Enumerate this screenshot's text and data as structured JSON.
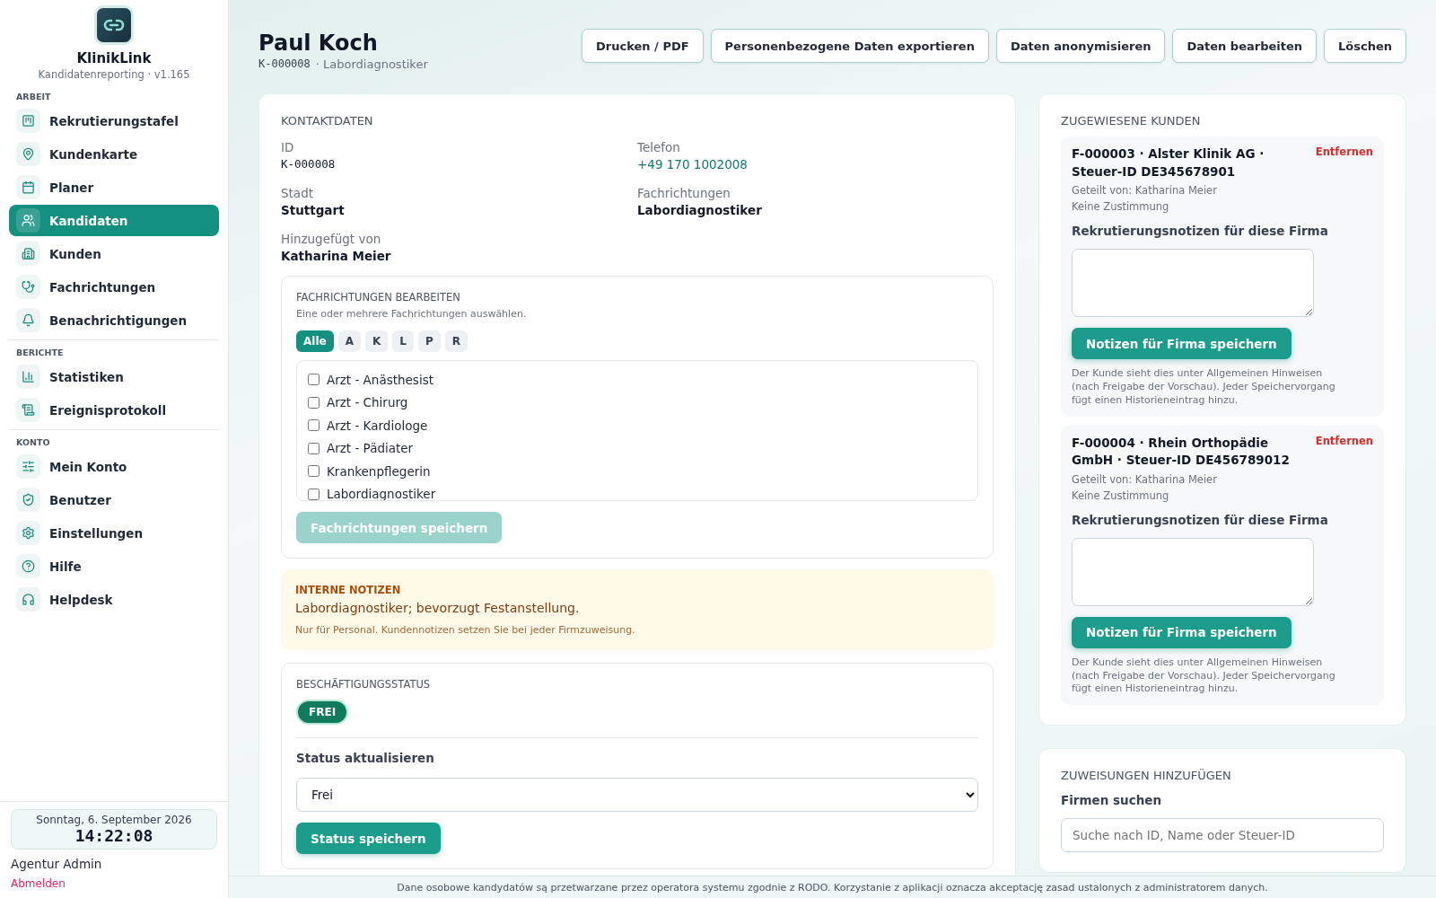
{
  "sidebar": {
    "brand": "KlinikLink",
    "subtitle": "Kandidatenreporting · v1.165",
    "sections": [
      {
        "heading": "ARBEIT",
        "items": [
          {
            "label": "Rekrutierungstafel",
            "selected": false
          },
          {
            "label": "Kundenkarte",
            "selected": false
          },
          {
            "label": "Planer",
            "selected": false
          },
          {
            "label": "Kandidaten",
            "selected": true
          },
          {
            "label": "Kunden",
            "selected": false
          },
          {
            "label": "Fachrichtungen",
            "selected": false
          },
          {
            "label": "Benachrichtigungen",
            "selected": false
          }
        ]
      },
      {
        "heading": "BERICHTE",
        "items": [
          {
            "label": "Statistiken",
            "selected": false
          },
          {
            "label": "Ereignisprotokoll",
            "selected": false
          }
        ]
      },
      {
        "heading": "KONTO",
        "items": [
          {
            "label": "Mein Konto",
            "selected": false
          },
          {
            "label": "Benutzer",
            "selected": false
          },
          {
            "label": "Einstellungen",
            "selected": false
          },
          {
            "label": "Hilfe",
            "selected": false
          },
          {
            "label": "Helpdesk",
            "selected": false
          }
        ]
      }
    ],
    "clock": {
      "date": "Sonntag, 6. September 2026",
      "time": "14:22:08"
    },
    "user": "Agentur Admin",
    "logout": "Abmelden"
  },
  "header": {
    "title": "Paul Koch",
    "id": "K-000008",
    "role": "· Labordiagnostiker",
    "actions": [
      "Drucken / PDF",
      "Personenbezogene Daten exportieren",
      "Daten anonymisieren",
      "Daten bearbeiten",
      "Löschen"
    ]
  },
  "contact": {
    "title": "KONTAKTDATEN",
    "fields": [
      {
        "label": "ID",
        "value": "K-000008",
        "kind": "mono"
      },
      {
        "label": "Telefon",
        "value": "+49 170 1002008",
        "kind": "link"
      },
      {
        "label": "Stadt",
        "value": "Stuttgart",
        "kind": "text"
      },
      {
        "label": "Fachrichtungen",
        "value": "Labordiagnostiker",
        "kind": "text"
      },
      {
        "label": "Hinzugefügt von",
        "value": "Katharina Meier",
        "kind": "text"
      }
    ]
  },
  "specialties": {
    "title": "FACHRICHTUNGEN BEARBEITEN",
    "hint": "Eine oder mehrere Fachrichtungen auswählen.",
    "filters": [
      {
        "label": "Alle",
        "selected": true
      },
      {
        "label": "A",
        "selected": false
      },
      {
        "label": "K",
        "selected": false
      },
      {
        "label": "L",
        "selected": false
      },
      {
        "label": "P",
        "selected": false
      },
      {
        "label": "R",
        "selected": false
      }
    ],
    "options": [
      {
        "label": "Arzt - Anästhesist",
        "checked": false
      },
      {
        "label": "Arzt - Chirurg",
        "checked": false
      },
      {
        "label": "Arzt - Kardiologe",
        "checked": false
      },
      {
        "label": "Arzt - Pädiater",
        "checked": false
      },
      {
        "label": "Krankenpflegerin",
        "checked": false
      },
      {
        "label": "Labordiagnostiker",
        "checked": false
      }
    ],
    "save": {
      "label": "Fachrichtungen speichern",
      "disabled": true
    }
  },
  "internal_notes": {
    "title": "INTERNE NOTIZEN",
    "text": "Labordiagnostiker; bevorzugt Festanstellung.",
    "hint": "Nur für Personal. Kundennotizen setzen Sie bei jeder Firmzuweisung."
  },
  "employment": {
    "title": "BESCHÄFTIGUNGSSTATUS",
    "badge": "FREI",
    "update_label": "Status aktualisieren",
    "select_value": "Frei",
    "save": "Status speichern"
  },
  "assigned": {
    "title": "ZUGEWIESENE KUNDEN",
    "clients": [
      {
        "name": "F-000003 · Alster Klinik AG · Steuer-ID DE345678901",
        "remove": "Entfernen",
        "shared_by": "Geteilt von: Katharina Meier",
        "consent": "Keine Zustimmung",
        "notes_label": "Rekrutierungsnotizen für diese Firma",
        "save": "Notizen für Firma speichern",
        "hint": "Der Kunde sieht dies unter Allgemeinen Hinweisen (nach Freigabe der Vorschau). Jeder Speichervorgang fügt einen Historieneintrag hinzu."
      },
      {
        "name": "F-000004 · Rhein Orthopädie GmbH · Steuer-ID DE456789012",
        "remove": "Entfernen",
        "shared_by": "Geteilt von: Katharina Meier",
        "consent": "Keine Zustimmung",
        "notes_label": "Rekrutierungsnotizen für diese Firma",
        "save": "Notizen für Firma speichern",
        "hint": "Der Kunde sieht dies unter Allgemeinen Hinweisen (nach Freigabe der Vorschau). Jeder Speichervorgang fügt einen Historieneintrag hinzu."
      }
    ]
  },
  "add_assignment": {
    "title": "ZUWEISUNGEN HINZUFÜGEN",
    "search_label": "Firmen suchen",
    "placeholder": "Suche nach ID, Name oder Steuer-ID"
  },
  "footer": "Dane osobowe kandydatów są przetwarzane przez operatora systemu zgodnie z RODO. Korzystanie z aplikacji oznacza akceptację zasad ustalonych z administratorem danych."
}
